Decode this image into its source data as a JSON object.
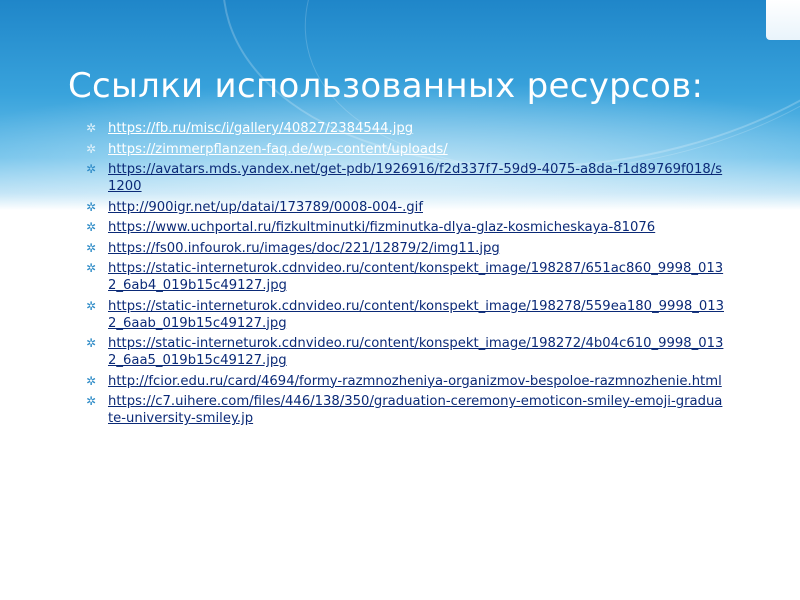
{
  "slide": {
    "title": "Ссылки использованных ресурсов:",
    "bullet_icon": "star-bullet-icon",
    "colors": {
      "header_blue": "#1f86c9",
      "link_color": "#0b2a77",
      "bullet_color": "#2e8bc7",
      "title_color": "#ffffff"
    },
    "links": [
      "https://fb.ru/misc/i/gallery/40827/2384544.jpg",
      "https://zimmerpflanzen-faq.de/wp-content/uploads/",
      "https://avatars.mds.yandex.net/get-pdb/1926916/f2d337f7-59d9-4075-a8da-f1d89769f018/s1200",
      "http://900igr.net/up/datai/173789/0008-004-.gif",
      "https://www.uchportal.ru/fizkultminutki/fizminutka-dlya-glaz-kosmicheskaya-81076",
      "https://fs00.infourok.ru/images/doc/221/12879/2/img11.jpg",
      "https://static-interneturok.cdnvideo.ru/content/konspekt_image/198287/651ac860_9998_0132_6ab4_019b15c49127.jpg",
      "https://static-interneturok.cdnvideo.ru/content/konspekt_image/198278/559ea180_9998_0132_6aab_019b15c49127.jpg",
      "https://static-interneturok.cdnvideo.ru/content/konspekt_image/198272/4b04c610_9998_0132_6aa5_019b15c49127.jpg",
      "http://fcior.edu.ru/card/4694/formy-razmnozheniya-organizmov-bespoloe-razmnozhenie.html",
      "https://c7.uihere.com/files/446/138/350/graduation-ceremony-emoticon-smiley-emoji-graduate-university-smiley.jp"
    ]
  }
}
